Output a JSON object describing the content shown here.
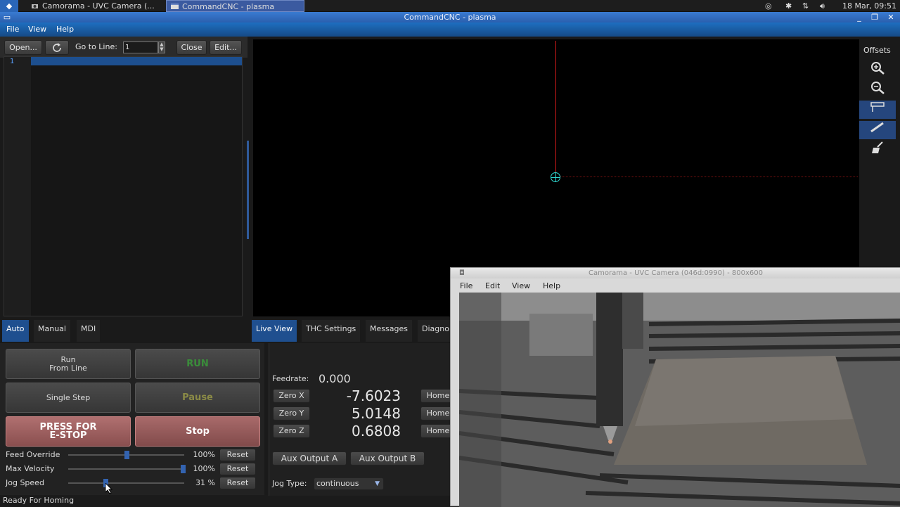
{
  "taskbar": {
    "tasks": [
      {
        "label": "Camorama - UVC Camera (..."
      },
      {
        "label": "CommandCNC - plasma"
      }
    ],
    "clock": "18 Mar, 09:51"
  },
  "window": {
    "title": "CommandCNC - plasma"
  },
  "menu": {
    "file": "File",
    "view": "View",
    "help": "Help"
  },
  "editor": {
    "open": "Open...",
    "go_to_line": "Go to Line:",
    "line_value": "1",
    "close": "Close",
    "edit": "Edit...",
    "line_number": "1"
  },
  "tool_strip": {
    "offsets": "Offsets",
    "icons": [
      "zoom-in-icon",
      "zoom-out-icon",
      "top-view-icon",
      "measure-icon",
      "clear-icon"
    ]
  },
  "left_tabs": [
    "Auto",
    "Manual",
    "MDI"
  ],
  "right_tabs": [
    "Live View",
    "THC Settings",
    "Messages",
    "Diagno"
  ],
  "controls": {
    "run_from_line_1": "Run",
    "run_from_line_2": "From Line",
    "run": "RUN",
    "single_step": "Single Step",
    "pause": "Pause",
    "estop_1": "PRESS FOR",
    "estop_2": "E-STOP",
    "stop": "Stop"
  },
  "sliders": [
    {
      "label": "Feed Override",
      "value": "100%",
      "reset": "Reset",
      "fraction": 0.5
    },
    {
      "label": "Max Velocity",
      "value": "100%",
      "reset": "Reset",
      "fraction": 1.0
    },
    {
      "label": "Jog Speed",
      "value": "31  %",
      "reset": "Reset",
      "fraction": 0.31
    }
  ],
  "status": "Ready For Homing",
  "live_view": {
    "feedrate_label": "Feedrate:",
    "feedrate_value": "0.000",
    "axes": [
      {
        "zero": "Zero X",
        "value": "-7.6023",
        "home": "Home"
      },
      {
        "zero": "Zero Y",
        "value": "5.0148",
        "home": "Home"
      },
      {
        "zero": "Zero Z",
        "value": "0.6808",
        "home": "Home"
      }
    ],
    "aux_a": "Aux Output A",
    "aux_b": "Aux Output B",
    "jog_type_label": "Jog Type:",
    "jog_type_value": "continuous"
  },
  "camorama": {
    "title": "Camorama - UVC Camera (046d:0990) - 800x600",
    "menu": [
      "File",
      "Edit",
      "View",
      "Help"
    ]
  }
}
